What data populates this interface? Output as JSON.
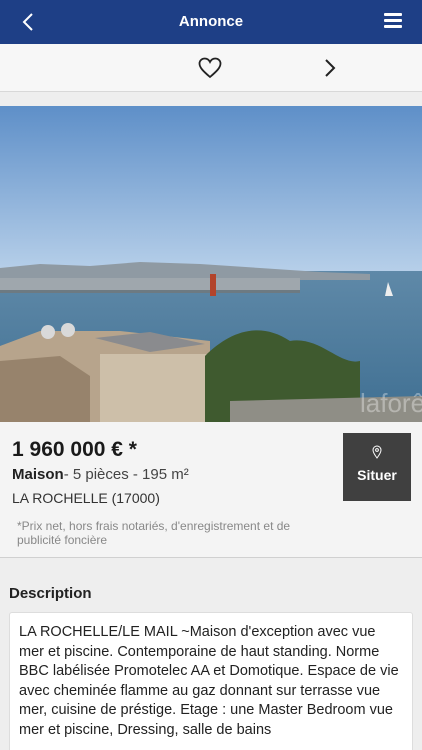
{
  "header": {
    "title": "Annonce",
    "back_icon": "chevron-left-icon",
    "menu_icon": "hamburger-menu-icon",
    "background": "#1e3f86"
  },
  "actions": {
    "favorite_icon": "heart-outline-icon",
    "next_icon": "chevron-right-icon"
  },
  "listing": {
    "price": "1 960 000 € *",
    "type": "Maison",
    "details": "- 5 pièces - 195 m²",
    "city": "LA ROCHELLE (17000)",
    "note": "*Prix net, hors frais notariés, d'enregistrement et de publicité foncière",
    "situer_label": "Situer",
    "situer_icon": "map-pin-icon"
  },
  "description": {
    "title": "Description",
    "text": "LA ROCHELLE/LE MAIL ~Maison d'exception avec vue mer et piscine. Contemporaine de haut standing. Norme BBC labélisée Promotelec AA et Domotique. Espace de vie avec cheminée flamme au gaz donnant sur terrasse vue mer, cuisine de préstige. Etage : une Master Bedroom vue mer et piscine, Dressing, salle de bains"
  }
}
